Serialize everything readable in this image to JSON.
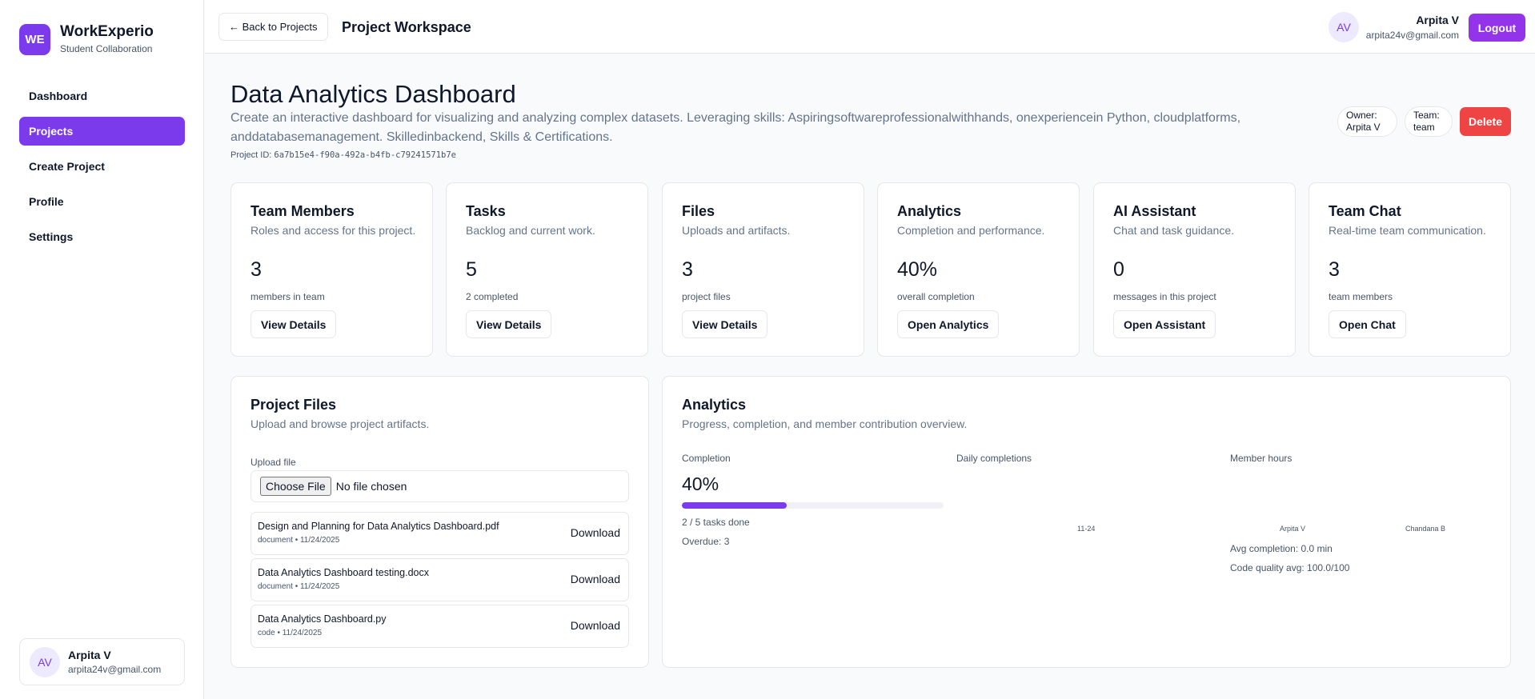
{
  "brand": {
    "logo": "WE",
    "title": "WorkExperio",
    "subtitle": "Student Collaboration"
  },
  "nav": {
    "items": [
      {
        "label": "Dashboard",
        "active": false
      },
      {
        "label": "Projects",
        "active": true
      },
      {
        "label": "Create Project",
        "active": false
      },
      {
        "label": "Profile",
        "active": false
      },
      {
        "label": "Settings",
        "active": false
      }
    ]
  },
  "sidebar_user": {
    "initials": "AV",
    "name": "Arpita V",
    "email": "arpita24v@gmail.com"
  },
  "header": {
    "back_label": "← Back to Projects",
    "title": "Project Workspace",
    "user_initials": "AV",
    "user_name": "Arpita V",
    "user_email": "arpita24v@gmail.com",
    "logout_label": "Logout"
  },
  "project": {
    "title": "Data Analytics Dashboard",
    "description": "Create an interactive dashboard for visualizing and analyzing complex datasets. Leveraging skills: Aspiringsoftwareprofessionalwithhands, onexperiencein Python, cloudplatforms, anddatabasemanagement. Skilledinbackend, Skills & Certifications.",
    "id_label": "Project ID:",
    "id_value": "6a7b15e4-f90a-492a-b4fb-c79241571b7e",
    "owner_label": "Owner:",
    "owner_value": "Arpita V",
    "team_label": "Team:",
    "team_value": "team",
    "delete_label": "Delete"
  },
  "cards": [
    {
      "title": "Team Members",
      "subtitle": "Roles and access for this project.",
      "stat": "3",
      "caption": "members in team",
      "button": "View Details"
    },
    {
      "title": "Tasks",
      "subtitle": "Backlog and current work.",
      "stat": "5",
      "caption": "2 completed",
      "button": "View Details"
    },
    {
      "title": "Files",
      "subtitle": "Uploads and artifacts.",
      "stat": "3",
      "caption": "project files",
      "button": "View Details"
    },
    {
      "title": "Analytics",
      "subtitle": "Completion and performance.",
      "stat": "40%",
      "caption": "overall completion",
      "button": "Open Analytics"
    },
    {
      "title": "AI Assistant",
      "subtitle": "Chat and task guidance.",
      "stat": "0",
      "caption": "messages in this project",
      "button": "Open Assistant"
    },
    {
      "title": "Team Chat",
      "subtitle": "Real-time team communication.",
      "stat": "3",
      "caption": "team members",
      "button": "Open Chat"
    }
  ],
  "files_panel": {
    "title": "Project Files",
    "subtitle": "Upload and browse project artifacts.",
    "upload_label": "Upload file",
    "choose_label": "Choose File",
    "no_file": "No file chosen",
    "download_label": "Download",
    "files": [
      {
        "name": "Design and Planning for Data Analytics Dashboard.pdf",
        "meta": "document • 11/24/2025"
      },
      {
        "name": "Data Analytics Dashboard testing.docx",
        "meta": "document • 11/24/2025"
      },
      {
        "name": "Data Analytics Dashboard.py",
        "meta": "code • 11/24/2025"
      }
    ]
  },
  "analytics_panel": {
    "title": "Analytics",
    "subtitle": "Progress, completion, and member contribution overview.",
    "completion_label": "Completion",
    "completion_value": "40%",
    "completion_fraction": 0.4,
    "tasks_done": "2 / 5 tasks done",
    "overdue": "Overdue: 3",
    "daily_label": "Daily completions",
    "daily_tick": "11-24",
    "hours_label": "Member hours",
    "members": [
      "Arpita V",
      "Chandana B"
    ],
    "avg_completion": "Avg completion: 0.0 min",
    "code_quality": "Code quality avg: 100.0/100"
  },
  "colors": {
    "accent": "#7c3aed",
    "logout": "#9333ea",
    "delete": "#ef4444"
  }
}
